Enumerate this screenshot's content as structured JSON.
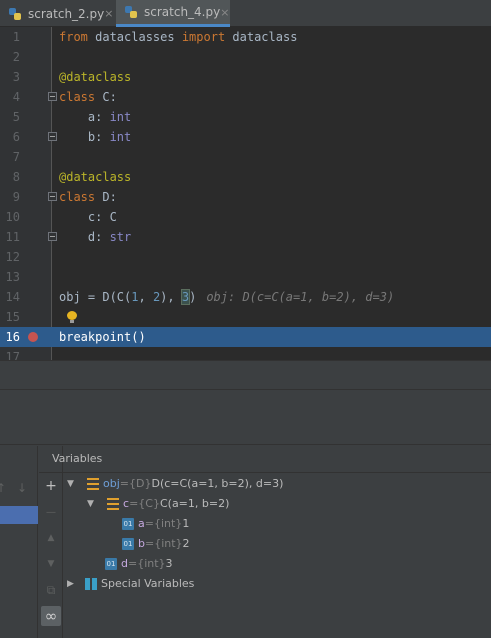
{
  "tabs": [
    {
      "label": "scratch_2.py",
      "close": "×",
      "active": false
    },
    {
      "label": "scratch_4.py",
      "close": "×",
      "active": true
    }
  ],
  "editor": {
    "lines": [
      {
        "num": "1"
      },
      {
        "num": "2"
      },
      {
        "num": "3"
      },
      {
        "num": "4"
      },
      {
        "num": "5"
      },
      {
        "num": "6"
      },
      {
        "num": "7"
      },
      {
        "num": "8"
      },
      {
        "num": "9"
      },
      {
        "num": "10"
      },
      {
        "num": "11"
      },
      {
        "num": "12"
      },
      {
        "num": "13"
      },
      {
        "num": "14"
      },
      {
        "num": "15"
      },
      {
        "num": "16"
      },
      {
        "num": "17"
      }
    ],
    "tokens": {
      "from": "from",
      "module": " dataclasses ",
      "import": "import",
      "name": " dataclass",
      "decorator": "@dataclass",
      "class_kw": "class",
      "class_c": " C:",
      "field_a": "    a: ",
      "field_b": "    b: ",
      "int": "int",
      "class_d": " D:",
      "field_c": "    c: C",
      "field_d": "    d: ",
      "str": "str",
      "obj_prefix": "obj = D(C(",
      "one": "1",
      "comma": ", ",
      "two": "2",
      "close_mid": "), ",
      "three": "3",
      "close_end": ")",
      "inline_value": "obj: D(c=C(a=1, b=2), d=3)",
      "breakpoint_call": "breakpoint()"
    }
  },
  "variables": {
    "title": "Variables",
    "tree": [
      {
        "arrow": "▼",
        "name": "obj",
        "eq": " = ",
        "type": "{D}",
        "value": " D(c=C(a=1, b=2), d=3)"
      },
      {
        "arrow": "▼",
        "name": "c",
        "eq": " = ",
        "type": "{C}",
        "value": " C(a=1, b=2)"
      },
      {
        "arrow": "",
        "icon": "01",
        "name": "a",
        "eq": " = ",
        "type": "{int}",
        "value": " 1"
      },
      {
        "arrow": "",
        "icon": "01",
        "name": "b",
        "eq": " = ",
        "type": "{int}",
        "value": " 2"
      },
      {
        "arrow": "",
        "icon": "01",
        "name": "d",
        "eq": " = ",
        "type": "{int}",
        "value": " 3"
      },
      {
        "arrow": "▶",
        "name": "Special Variables"
      }
    ],
    "toolbar": {
      "add": "+",
      "remove": "—",
      "up": "▲",
      "down": "▼",
      "copy": "⧉",
      "watch": "∞"
    }
  },
  "frames": {
    "up_arrow": "↑",
    "down_arrow": "↓"
  },
  "colors": {
    "accent": "#4b6eaf",
    "selection": "#2d5b8c",
    "breakpoint": "#c75450"
  }
}
